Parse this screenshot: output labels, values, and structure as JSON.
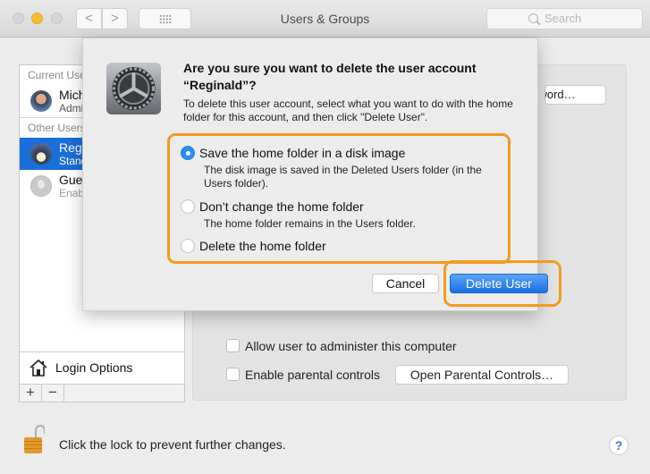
{
  "window": {
    "title": "Users & Groups",
    "search_placeholder": "Search",
    "back_glyph": "<",
    "forward_glyph": ">"
  },
  "sidebar": {
    "current_section": "Current User",
    "other_section": "Other Users",
    "users": [
      {
        "name": "Michael",
        "role": "Admin",
        "avatar": "photo-avatar",
        "selected": false
      },
      {
        "name": "Reginald",
        "role": "Standard",
        "avatar": "photo-avatar",
        "selected": true
      },
      {
        "name": "Guest User",
        "role": "Enabled",
        "avatar": "generic-user-icon",
        "selected": false
      }
    ],
    "login_options": "Login Options",
    "add_label": "+",
    "remove_label": "−"
  },
  "panel": {
    "password_button": "Reset Password…",
    "allow_admin": {
      "label": "Allow user to administer this computer",
      "checked": false
    },
    "parental": {
      "label": "Enable parental controls",
      "checked": false
    },
    "open_parental_button": "Open Parental Controls…"
  },
  "footer": {
    "lock_text": "Click the lock to prevent further changes.",
    "help_label": "?"
  },
  "dialog": {
    "title": "Are you sure you want to delete the user account “Reginald”?",
    "message": "To delete this user account, select what you want to do with the home folder for this account, and then click \"Delete User\".",
    "options": [
      {
        "label": "Save the home folder in a disk image",
        "description": "The disk image is saved in the Deleted Users folder (in the Users folder).",
        "selected": true
      },
      {
        "label": "Don’t change the home folder",
        "description": "The home folder remains in the Users folder.",
        "selected": false
      },
      {
        "label": "Delete the home folder",
        "description": "",
        "selected": false
      }
    ],
    "cancel_button": "Cancel",
    "delete_button": "Delete User",
    "highlight_color": "#f39a1f",
    "accent_color": "#1a6fe4"
  }
}
